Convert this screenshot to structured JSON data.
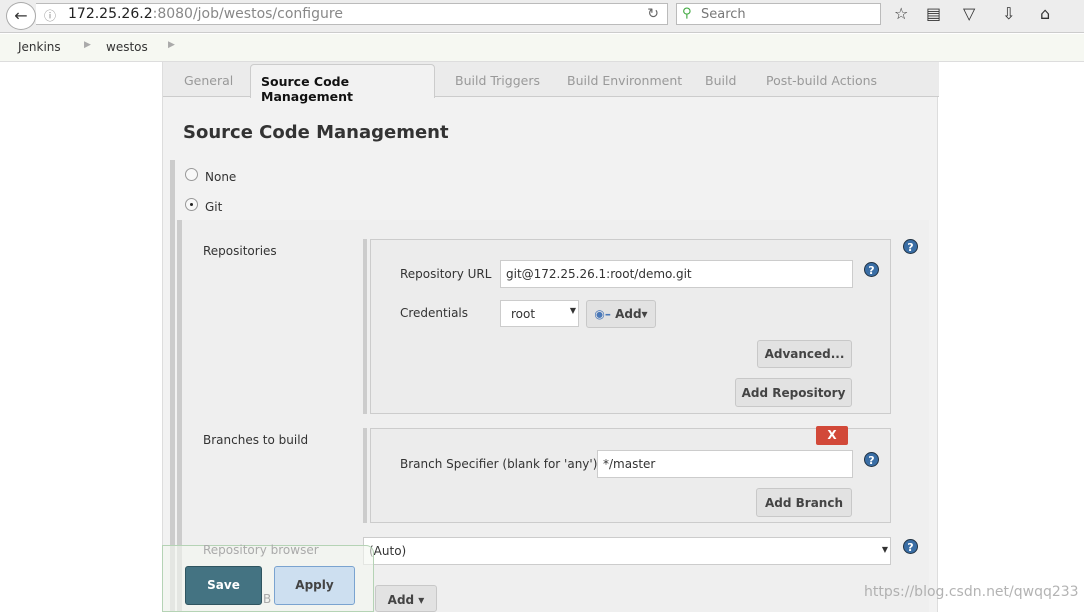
{
  "browser": {
    "url_host": "172.25.26.2",
    "url_path": ":8080/job/westos/configure",
    "search_placeholder": "Search"
  },
  "breadcrumbs": [
    "Jenkins",
    "westos"
  ],
  "tabs": [
    "General",
    "Source Code Management",
    "Build Triggers",
    "Build Environment",
    "Build",
    "Post-build Actions"
  ],
  "section_title": "Source Code Management",
  "scm": {
    "none_label": "None",
    "git_label": "Git",
    "selected": "Git"
  },
  "repositories": {
    "label": "Repositories",
    "url_label": "Repository URL",
    "url_value": "git@172.25.26.1:root/demo.git",
    "credentials_label": "Credentials",
    "credentials_value": "root",
    "add_label": "Add",
    "advanced_label": "Advanced...",
    "add_repository_label": "Add Repository"
  },
  "branches": {
    "label": "Branches to build",
    "delete_label": "X",
    "specifier_label": "Branch Specifier (blank for 'any')",
    "specifier_value": "*/master",
    "add_branch_label": "Add Branch"
  },
  "repo_browser": {
    "label": "Repository browser",
    "value": "(Auto)"
  },
  "additional": {
    "label_partial": "B",
    "add_label": "Add"
  },
  "footer": {
    "save_label": "Save",
    "apply_label": "Apply"
  },
  "watermark": "https://blog.csdn.net/qwqq233",
  "colors": {
    "save": "#447382",
    "apply": "#cddff0",
    "delete": "#d24939"
  }
}
